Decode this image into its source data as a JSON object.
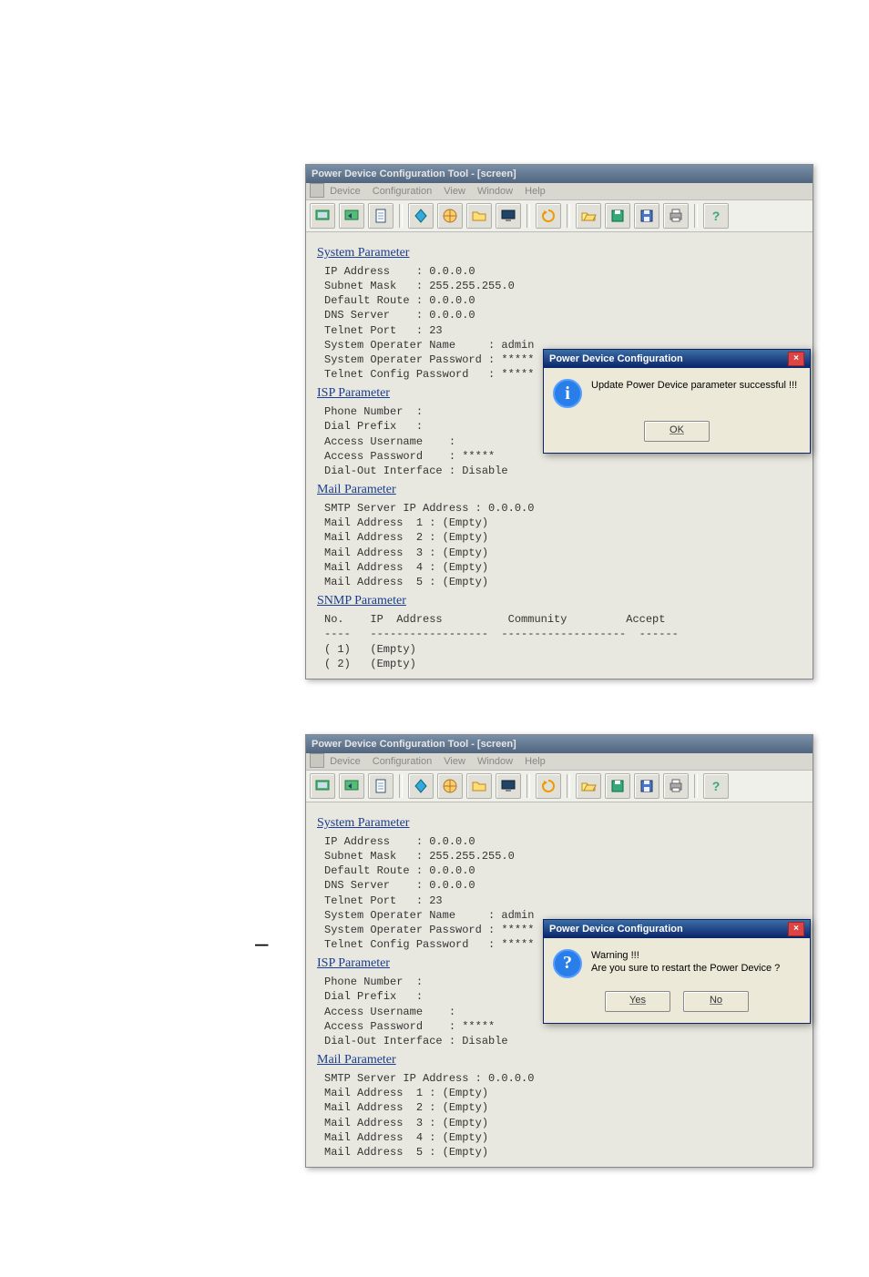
{
  "app": {
    "title": "Power Device Configuration Tool - [screen]",
    "menu": [
      "Device",
      "Configuration",
      "View",
      "Window",
      "Help"
    ]
  },
  "toolbar_icons": [
    "device-icon",
    "device-back-icon",
    "document-icon",
    "separator",
    "diamond-icon",
    "globe-icon",
    "folder-icon",
    "monitor-icon",
    "separator",
    "refresh-icon",
    "separator",
    "open-icon",
    "disk-icon",
    "save-icon",
    "printer-icon",
    "separator",
    "help-icon"
  ],
  "sections": {
    "system": {
      "title": "System Parameter",
      "lines": [
        "IP Address    : 0.0.0.0",
        "Subnet Mask   : 255.255.255.0",
        "Default Route : 0.0.0.0",
        "DNS Server    : 0.0.0.0",
        "Telnet Port   : 23",
        "System Operater Name     : admin",
        "System Operater Password : *****",
        "Telnet Config Password   : *****"
      ]
    },
    "isp": {
      "title": "ISP Parameter",
      "lines": [
        "Phone Number  :",
        "Dial Prefix   :",
        "Access Username    :",
        "Access Password    : *****",
        "Dial-Out Interface : Disable"
      ]
    },
    "mail": {
      "title": "Mail Parameter",
      "lines": [
        "SMTP Server IP Address : 0.0.0.0",
        "Mail Address  1 : (Empty)",
        "Mail Address  2 : (Empty)",
        "Mail Address  3 : (Empty)",
        "Mail Address  4 : (Empty)",
        "Mail Address  5 : (Empty)"
      ]
    },
    "snmp": {
      "title": "SNMP Parameter",
      "header": "No.    IP  Address          Community         Accept",
      "sep": "----   ------------------  -------------------  ------",
      "rows": [
        "( 1)   (Empty)",
        "( 2)   (Empty)"
      ]
    }
  },
  "dialog1": {
    "title": "Power Device Configuration",
    "message": "Update Power Device parameter successful !!!",
    "ok": "OK"
  },
  "dialog2": {
    "title": "Power Device Configuration",
    "line1": "Warning !!!",
    "line2": "Are you sure to restart the Power Device ?",
    "yes": "Yes",
    "no": "No"
  }
}
